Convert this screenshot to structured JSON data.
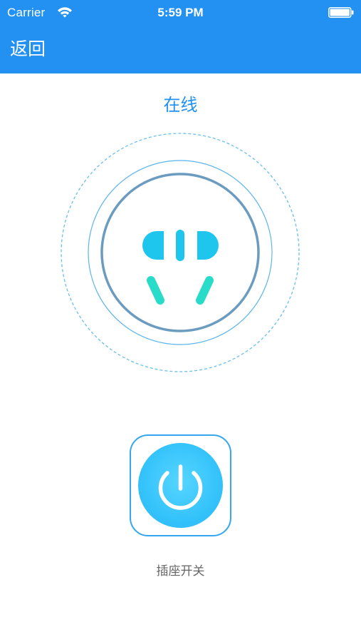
{
  "status_bar": {
    "carrier": "Carrier",
    "time": "5:59 PM",
    "wifi_icon": "wifi-icon",
    "battery_icon": "battery-icon"
  },
  "nav": {
    "back_label": "返回"
  },
  "device": {
    "status_label": "在线",
    "socket_icon": "socket-icon"
  },
  "power": {
    "icon": "power-icon",
    "label": "插座开关"
  },
  "colors": {
    "header_bg": "#2391f2",
    "accent_text": "#2391f2",
    "ring_dark": "#6b9cc0",
    "ring_light": "#5ab4ec",
    "socket_hole": "#1ec6ee",
    "socket_hole_lower": "#29dcc9",
    "power_fill": "#35c3fb",
    "power_border": "#34a7ee",
    "label_gray": "#666666"
  }
}
